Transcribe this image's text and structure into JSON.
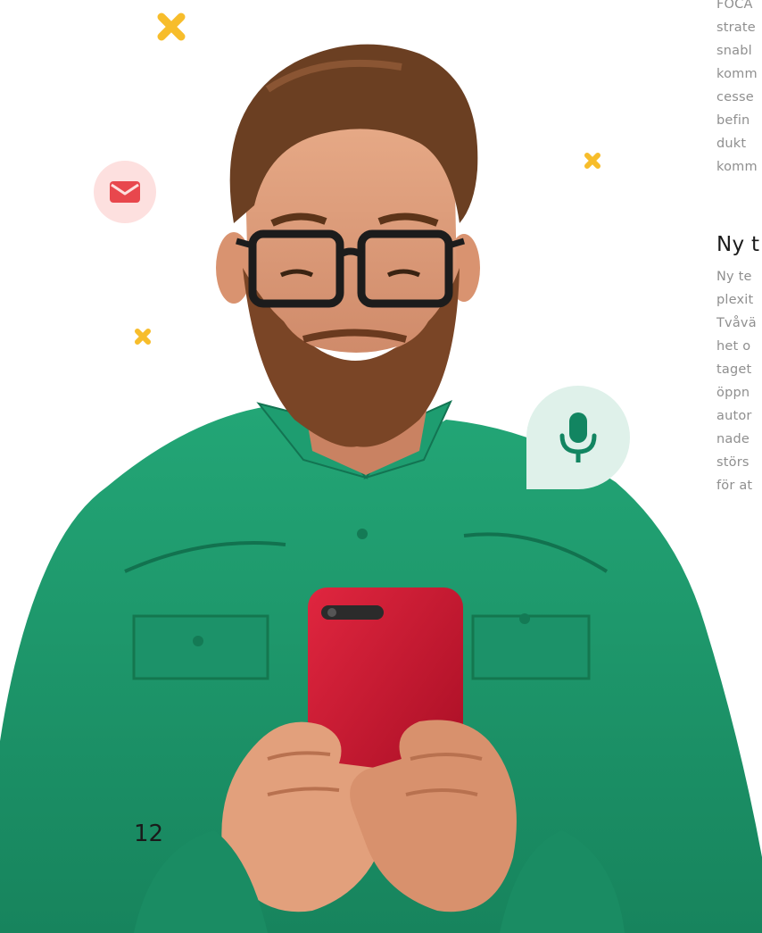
{
  "page": {
    "page_number": "12"
  },
  "column": {
    "para1_lines": [
      "FOCA",
      "strate",
      "snabl",
      "komm",
      "cesse",
      "befin",
      "dukt",
      "komm"
    ],
    "heading": "Ny t",
    "para2_lines": [
      "Ny te",
      "plexit",
      "Tvåvä",
      "het o",
      "taget",
      "öppn",
      "autor",
      "nade",
      "störs",
      "för at"
    ]
  },
  "decorations": {
    "mail_icon": "envelope-icon",
    "mic_icon": "microphone-icon",
    "cross_icon": "cross-icon",
    "colors": {
      "shirt": "#1f9a6f",
      "phone": "#c8102e",
      "cross": "#f7bd2b",
      "mail_bg": "#fde0df",
      "mail_icon": "#e8474d",
      "mic_bg": "#dff1ea",
      "mic_icon": "#128561"
    }
  }
}
